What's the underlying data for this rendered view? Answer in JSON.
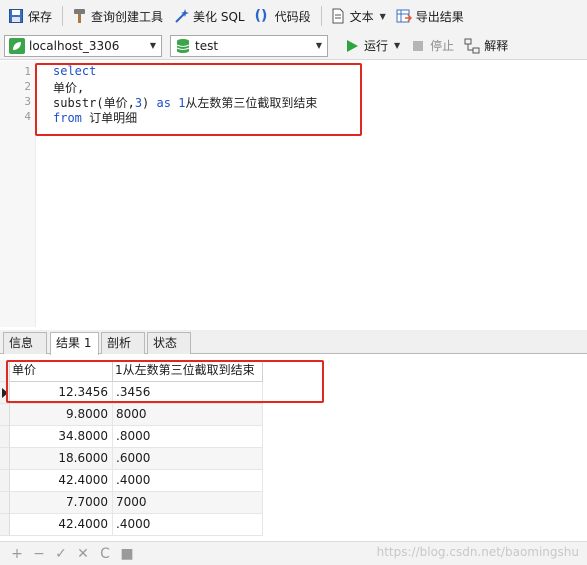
{
  "toolbar": {
    "save": "保存",
    "query_builder": "查询创建工具",
    "beautify": "美化 SQL",
    "snippet": "代码段",
    "text": "文本",
    "export": "导出结果"
  },
  "connbar": {
    "connection": "localhost_3306",
    "database": "test",
    "run": "运行",
    "stop": "停止",
    "explain": "解释"
  },
  "editor": {
    "line_numbers": [
      "1",
      "2",
      "3",
      "4"
    ],
    "lines": [
      [
        {
          "t": "select",
          "c": "kw"
        }
      ],
      [
        {
          "t": "单价,",
          "c": "plain"
        }
      ],
      [
        {
          "t": "substr(单价,",
          "c": "plain"
        },
        {
          "t": "3",
          "c": "num"
        },
        {
          "t": ") ",
          "c": "plain"
        },
        {
          "t": "as",
          "c": "kw"
        },
        {
          "t": " ",
          "c": "plain"
        },
        {
          "t": "1",
          "c": "num"
        },
        {
          "t": "从左数第三位截取到结束",
          "c": "plain"
        }
      ],
      [
        {
          "t": "from",
          "c": "kw"
        },
        {
          "t": " 订单明细",
          "c": "plain"
        }
      ]
    ]
  },
  "tabs": [
    "信息",
    "结果 1",
    "剖析",
    "状态"
  ],
  "result": {
    "columns": [
      "单价",
      "1从左数第三位截取到结束"
    ],
    "rows": [
      [
        "12.3456",
        ".3456"
      ],
      [
        "9.8000",
        "8000"
      ],
      [
        "34.8000",
        ".8000"
      ],
      [
        "18.6000",
        ".6000"
      ],
      [
        "42.4000",
        ".4000"
      ],
      [
        "7.7000",
        "7000"
      ],
      [
        "42.4000",
        ".4000"
      ]
    ]
  },
  "footer": {
    "icons": [
      "+",
      "−",
      "✓",
      "✕",
      "C",
      "■"
    ]
  },
  "watermark": "https://blog.csdn.net/baomingshu"
}
